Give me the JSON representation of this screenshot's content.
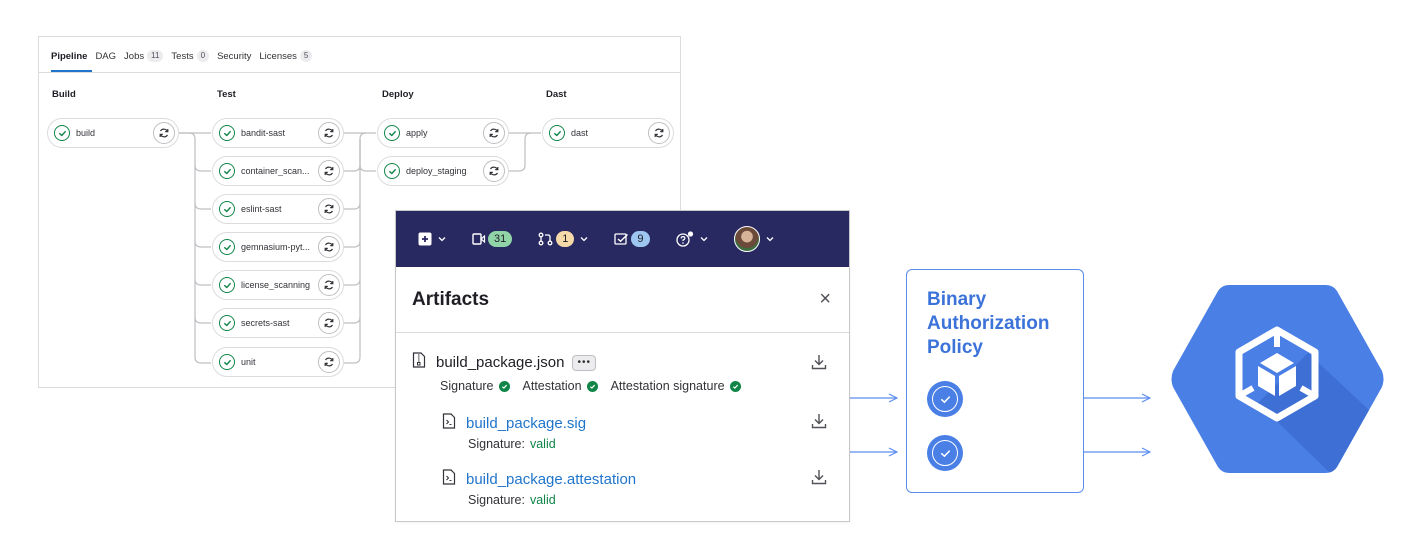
{
  "pipeline": {
    "tabs": [
      {
        "label": "Pipeline",
        "count": ""
      },
      {
        "label": "DAG",
        "count": ""
      },
      {
        "label": "Jobs",
        "count": "11"
      },
      {
        "label": "Tests",
        "count": "0"
      },
      {
        "label": "Security",
        "count": ""
      },
      {
        "label": "Licenses",
        "count": "5"
      }
    ],
    "stages": [
      "Build",
      "Test",
      "Deploy",
      "Dast"
    ],
    "jobs": {
      "build": [
        "build"
      ],
      "test": [
        "bandit-sast",
        "container_scan...",
        "eslint-sast",
        "gemnasium-pyt...",
        "license_scanning",
        "secrets-sast",
        "unit"
      ],
      "deploy": [
        "apply",
        "deploy_staging"
      ],
      "dast": [
        "dast"
      ]
    }
  },
  "topbar": {
    "issues_count": "31",
    "merge_requests_count": "1",
    "todos_count": "9"
  },
  "artifacts": {
    "title": "Artifacts",
    "close": "×",
    "main_file": "build_package.json",
    "more": "•••",
    "signature_label": "Signature",
    "attestation_label": "Attestation",
    "attestation_signature_label": "Attestation signature",
    "files": [
      {
        "name": "build_package.sig",
        "status_label": "Signature:",
        "status": "valid"
      },
      {
        "name": "build_package.attestation",
        "status_label": "Signature:",
        "status": "valid"
      }
    ]
  },
  "policy": {
    "title_line1": "Binary",
    "title_line2": "Authorization",
    "title_line3": "Policy"
  },
  "colors": {
    "success": "#108548",
    "navbar": "#292961",
    "link": "#1f75cb",
    "policy_blue": "#3c73d9",
    "kube_blue": "#4a7fe6"
  }
}
